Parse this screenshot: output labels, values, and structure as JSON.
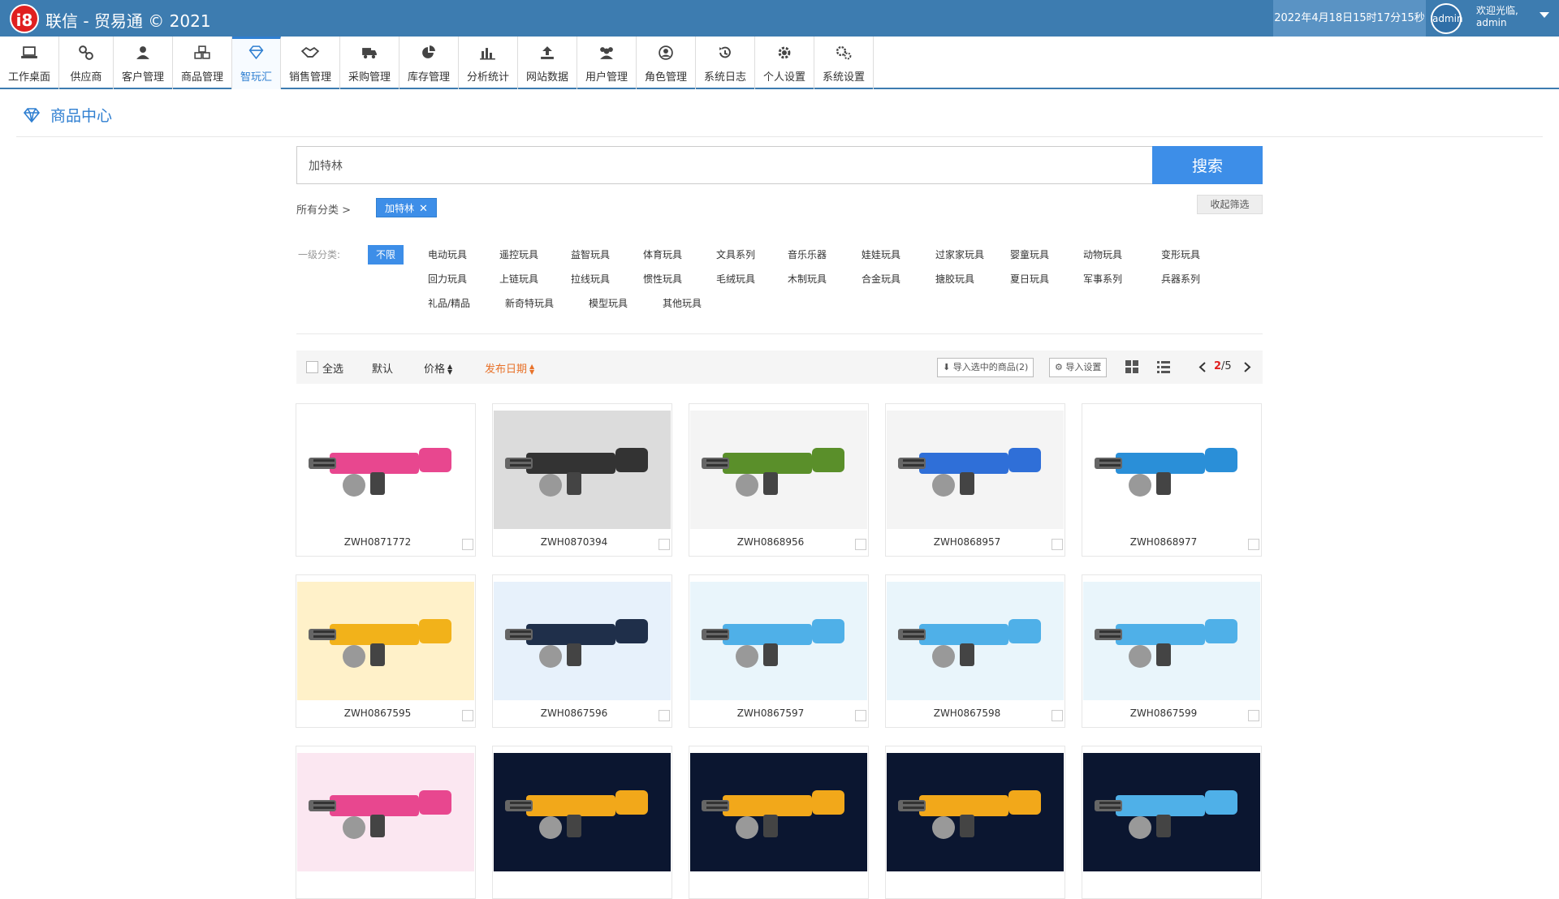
{
  "header": {
    "logo_text": "i8",
    "app_title": "联信 - 贸易通 © 2021",
    "datetime": "2022年4月18日15时17分15秒",
    "avatar_text": "admin",
    "welcome_line1": "欢迎光临,",
    "welcome_line2": "admin"
  },
  "nav": [
    {
      "label": "工作桌面",
      "icon": "laptop-icon"
    },
    {
      "label": "供应商",
      "icon": "link-icon"
    },
    {
      "label": "客户管理",
      "icon": "user-icon"
    },
    {
      "label": "商品管理",
      "icon": "cubes-icon"
    },
    {
      "label": "智玩汇",
      "icon": "diamond-icon",
      "active": true
    },
    {
      "label": "销售管理",
      "icon": "handshake-icon"
    },
    {
      "label": "采购管理",
      "icon": "truck-icon"
    },
    {
      "label": "库存管理",
      "icon": "pie-chart-icon"
    },
    {
      "label": "分析统计",
      "icon": "bar-chart-icon"
    },
    {
      "label": "网站数据",
      "icon": "upload-icon"
    },
    {
      "label": "用户管理",
      "icon": "users-icon"
    },
    {
      "label": "角色管理",
      "icon": "user-circle-icon"
    },
    {
      "label": "系统日志",
      "icon": "history-icon"
    },
    {
      "label": "个人设置",
      "icon": "gear-icon"
    },
    {
      "label": "系统设置",
      "icon": "gears-icon"
    }
  ],
  "page": {
    "title": "商品中心"
  },
  "search": {
    "value": "加特林",
    "button": "搜索"
  },
  "filters": {
    "crumb": "所有分类 >",
    "active_tag": "加特林",
    "collapse": "收起筛选",
    "category_label": "一级分类:",
    "all_label": "不限",
    "rows": [
      [
        "电动玩具",
        "遥控玩具",
        "益智玩具",
        "体育玩具",
        "文具系列",
        "音乐乐器",
        "娃娃玩具",
        "过家家玩具",
        "婴童玩具",
        "动物玩具",
        "变形玩具"
      ],
      [
        "回力玩具",
        "上链玩具",
        "拉线玩具",
        "惯性玩具",
        "毛绒玩具",
        "木制玩具",
        "合金玩具",
        "搪胶玩具",
        "夏日玩具",
        "军事系列",
        "兵器系列"
      ],
      [
        "礼品/精品",
        "新奇特玩具",
        "模型玩具",
        "其他玩具"
      ]
    ]
  },
  "toolbar": {
    "select_all": "全选",
    "default_sort": "默认",
    "price_sort": "价格",
    "date_sort": "发布日期",
    "import_selected": "导入选中的商品(2)",
    "import_settings": "导入设置",
    "page_current": "2",
    "page_total": "/5"
  },
  "products": [
    {
      "code": "ZWH0871772",
      "bg": "#ffffff",
      "accent": "#e8478f"
    },
    {
      "code": "ZWH0870394",
      "bg": "#dcdcdc",
      "accent": "#333333"
    },
    {
      "code": "ZWH0868956",
      "bg": "#f4f4f4",
      "accent": "#5a8f2a"
    },
    {
      "code": "ZWH0868957",
      "bg": "#f4f4f4",
      "accent": "#2f6fd8"
    },
    {
      "code": "ZWH0868977",
      "bg": "#ffffff",
      "accent": "#2a8fd8"
    },
    {
      "code": "ZWH0867595",
      "bg": "#fff1c9",
      "accent": "#f2b21a"
    },
    {
      "code": "ZWH0867596",
      "bg": "#e7f1fb",
      "accent": "#1f2f4a"
    },
    {
      "code": "ZWH0867597",
      "bg": "#e9f5fb",
      "accent": "#4fb0e8"
    },
    {
      "code": "ZWH0867598",
      "bg": "#e9f5fb",
      "accent": "#4fb0e8"
    },
    {
      "code": "ZWH0867599",
      "bg": "#e9f5fb",
      "accent": "#4fb0e8"
    },
    {
      "code": "",
      "bg": "#fbe7f1",
      "accent": "#e8478f"
    },
    {
      "code": "",
      "bg": "#0b1630",
      "accent": "#f2a81a"
    },
    {
      "code": "",
      "bg": "#0b1630",
      "accent": "#f2a81a"
    },
    {
      "code": "",
      "bg": "#0b1630",
      "accent": "#f2a81a"
    },
    {
      "code": "",
      "bg": "#0b1630",
      "accent": "#4fb0e8"
    }
  ],
  "colors": {
    "header": "#3d7cb0",
    "accent": "#2f7fd1",
    "button": "#3d8ee8",
    "sort_active": "#e8722a"
  }
}
